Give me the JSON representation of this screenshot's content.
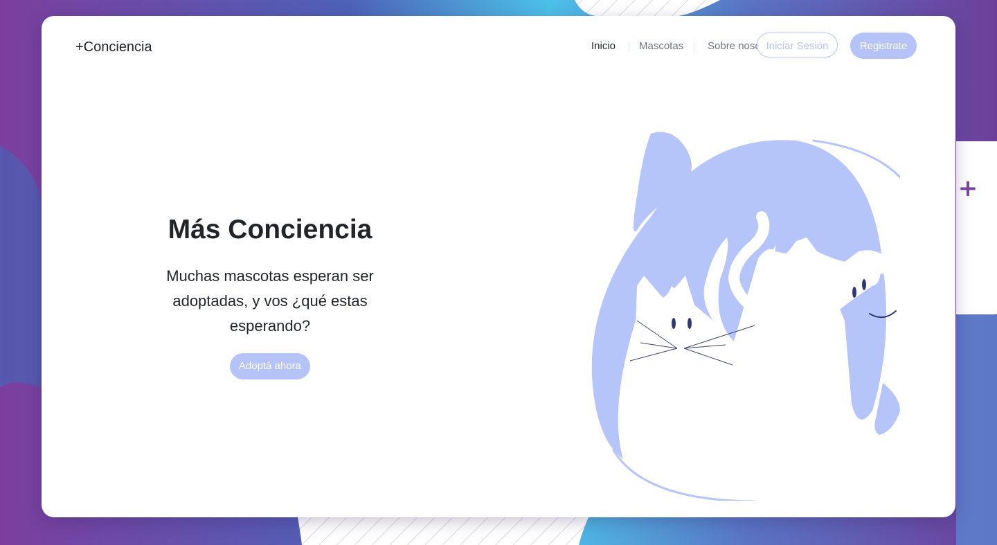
{
  "brand": "+Conciencia",
  "nav": {
    "links": [
      "Inicio",
      "Mascotas",
      "Sobre nosotros"
    ],
    "active": "Inicio",
    "login_label": "Iniciar Sesión",
    "register_label": "Registrate"
  },
  "hero": {
    "title": "Más Conciencia",
    "text": "Muchas mascotas esperan ser adoptadas, y vos ¿qué estas esperando?",
    "cta_label": "Adoptá ahora"
  },
  "side_widget": {
    "icon": "plus-icon",
    "symbol": "+"
  },
  "illustration": {
    "icon": "cat-and-dog-illustration"
  },
  "colors": {
    "accent": "#b5c3f8",
    "text": "#212529",
    "muted": "#6c757d",
    "plus": "#7a46a0",
    "background_gradient": [
      "#7a3f9d",
      "#4f6cc0",
      "#4cc3ea"
    ]
  }
}
